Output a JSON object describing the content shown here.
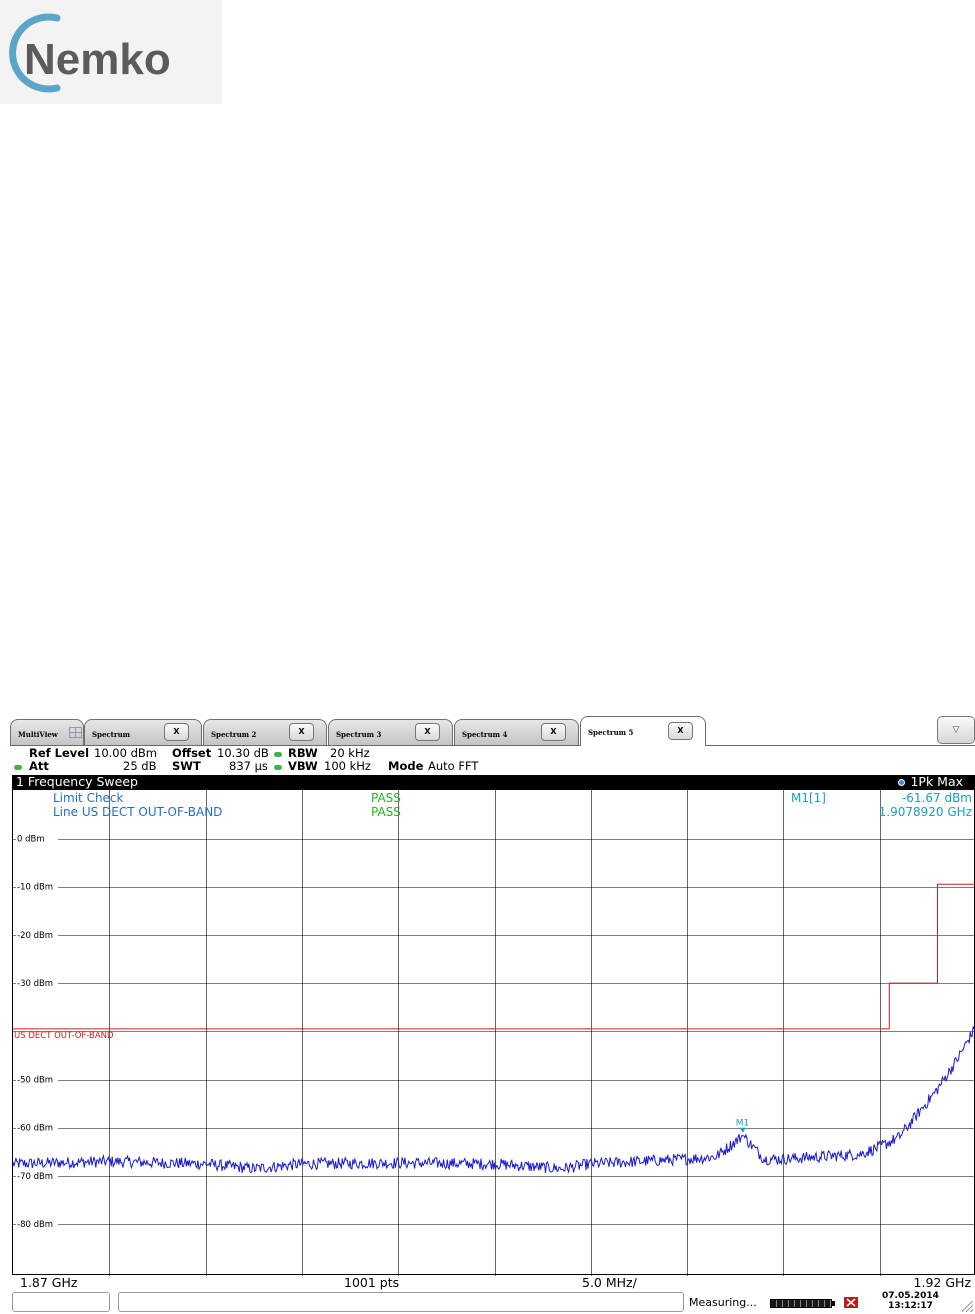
{
  "logo": {
    "text": "Nemko",
    "ring_color": "#5aa6c8",
    "text_color": "#5b5b5b"
  },
  "tabs": [
    {
      "label": "MultiView",
      "close": ""
    },
    {
      "label": "Spectrum",
      "close": "X"
    },
    {
      "label": "Spectrum 2",
      "close": "X"
    },
    {
      "label": "Spectrum 3",
      "close": "X"
    },
    {
      "label": "Spectrum 4",
      "close": "X"
    },
    {
      "label": "Spectrum 5",
      "close": "X",
      "active": true
    }
  ],
  "dropdown": {
    "icon": "triangle-down-icon",
    "glyph": "▽"
  },
  "settings": {
    "ref_level_label": "Ref Level",
    "ref_level": "10.00 dBm",
    "offset_label": "Offset",
    "offset": "10.30 dB",
    "rbw_label": "RBW",
    "rbw": "20 kHz",
    "att_label": "Att",
    "att": "25 dB",
    "swt_label": "SWT",
    "swt": "837 µs",
    "vbw_label": "VBW",
    "vbw": "100 kHz",
    "mode_label": "Mode",
    "mode": "Auto FFT"
  },
  "diagram": {
    "title": "1 Frequency Sweep",
    "trace": "1Pk Max"
  },
  "overlay": {
    "limit_check_label": "Limit Check",
    "limit_check_result": "PASS",
    "line_label": "Line US DECT OUT-OF-BAND",
    "line_result": "PASS",
    "marker_label": "M1[1]",
    "marker_level": "-61.67 dBm",
    "marker_freq": "1.9078920 GHz",
    "limit_line_name": "US DECT OUT-OF-BAND",
    "marker_tag": "M1"
  },
  "footer": {
    "start": "1.87 GHz",
    "points": "1001 pts",
    "span_per_div": "5.0 MHz/",
    "stop": "1.92 GHz"
  },
  "status": {
    "measuring": "Measuring...",
    "date": "07.05.2014",
    "time": "13:12:17"
  },
  "colors": {
    "trace": "#1a1ad0",
    "limit": "#cc2020",
    "pass": "#22b722",
    "info": "#1e6fd0",
    "marker": "#17a0c8"
  },
  "chart_data": {
    "type": "line",
    "title": "1 Frequency Sweep",
    "xlabel": "",
    "ylabel": "",
    "x_unit": "GHz",
    "y_unit": "dBm",
    "xlim": [
      1.87,
      1.92
    ],
    "ylim": [
      -90,
      10
    ],
    "y_ticks": [
      0,
      -10,
      -20,
      -30,
      -50,
      -60,
      -70,
      -80
    ],
    "y_tick_labels": [
      "0 dBm",
      "-10 dBm",
      "-20 dBm",
      "-30 dBm",
      "-50 dBm",
      "-60 dBm",
      "-70 dBm",
      "-80 dBm"
    ],
    "grid": true,
    "series": [
      {
        "name": "1Pk Max",
        "x": [
          1.87,
          1.875,
          1.88,
          1.8825,
          1.885,
          1.89,
          1.895,
          1.8985,
          1.9,
          1.905,
          1.9065,
          1.9079,
          1.909,
          1.91,
          1.912,
          1.914,
          1.915,
          1.916,
          1.917,
          1.918,
          1.919,
          1.92
        ],
        "y": [
          -67.5,
          -67,
          -67.5,
          -68.5,
          -67.5,
          -67.3,
          -67.5,
          -68.5,
          -67.5,
          -66.5,
          -66,
          -61.67,
          -66.5,
          -66.5,
          -66,
          -65.5,
          -64,
          -62,
          -57,
          -52,
          -46,
          -39
        ]
      }
    ],
    "limit_lines": [
      {
        "name": "US DECT OUT-OF-BAND",
        "x": [
          1.87,
          1.9155,
          1.9155,
          1.918,
          1.918,
          1.92
        ],
        "y": [
          -39.5,
          -39.5,
          -30,
          -30,
          -9.5,
          -9.5
        ]
      }
    ],
    "markers": [
      {
        "name": "M1",
        "x": 1.907892,
        "y": -61.67
      }
    ]
  }
}
